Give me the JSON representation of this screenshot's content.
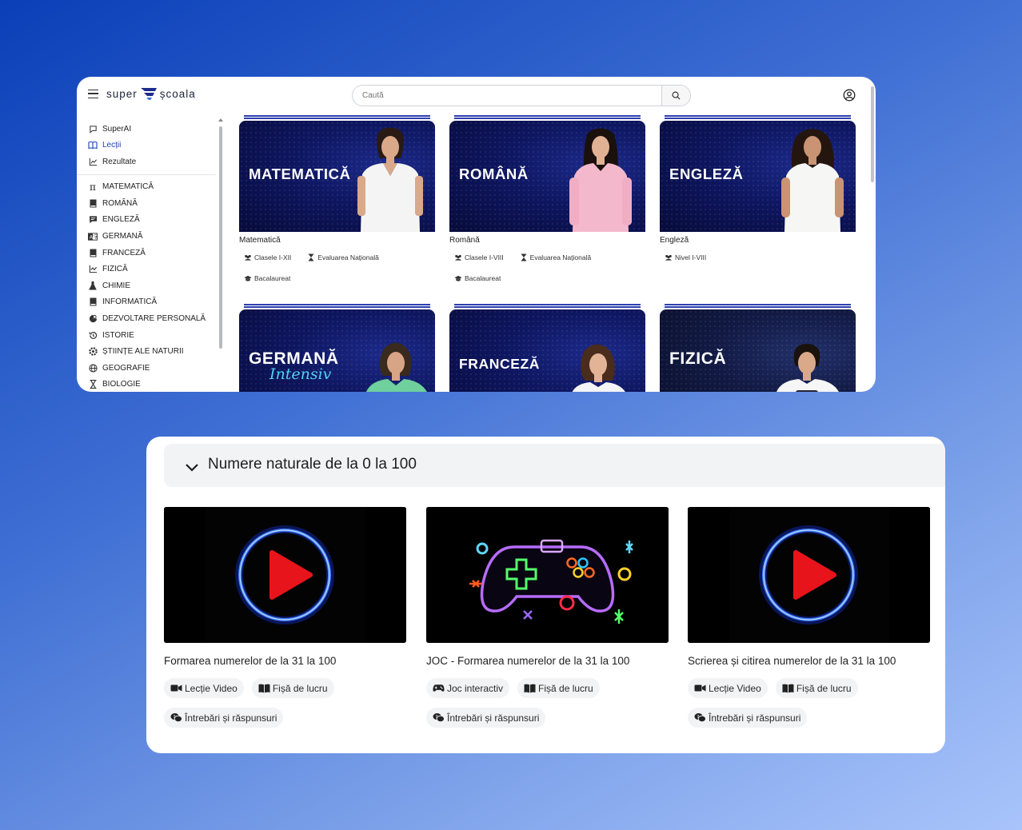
{
  "app": {
    "logo": {
      "left": "super",
      "right": "școala"
    },
    "search": {
      "placeholder": "Caută"
    },
    "sidebar": {
      "top_items": [
        {
          "label": "SuperAI",
          "icon": "chat-icon"
        },
        {
          "label": "Lecții",
          "icon": "book-icon",
          "active": true
        },
        {
          "label": "Rezultate",
          "icon": "chart-icon"
        }
      ],
      "subjects": [
        {
          "label": "MATEMATICĂ",
          "icon": "pi-icon"
        },
        {
          "label": "ROMÂNĂ",
          "icon": "book-icon"
        },
        {
          "label": "ENGLEZĂ",
          "icon": "speech-icon"
        },
        {
          "label": "GERMANĂ",
          "icon": "language-icon"
        },
        {
          "label": "FRANCEZĂ",
          "icon": "book-icon"
        },
        {
          "label": "FIZICĂ",
          "icon": "graph-icon"
        },
        {
          "label": "CHIMIE",
          "icon": "flask-icon"
        },
        {
          "label": "INFORMATICĂ",
          "icon": "book-icon"
        },
        {
          "label": "DEZVOLTARE PERSONALĂ",
          "icon": "brain-icon"
        },
        {
          "label": "ISTORIE",
          "icon": "history-icon"
        },
        {
          "label": "ȘTIINȚE ALE NATURII",
          "icon": "atom-icon"
        },
        {
          "label": "GEOGRAFIE",
          "icon": "globe-icon"
        },
        {
          "label": "BIOLOGIE",
          "icon": "hourglass-icon"
        }
      ]
    },
    "cards": [
      {
        "title": "MATEMATICĂ",
        "name": "Matematică",
        "tags": [
          {
            "label": "Clasele I-XII",
            "icon": "users-icon"
          },
          {
            "label": "Evaluarea Națională",
            "icon": "hourglass-icon"
          },
          {
            "label": "Bacalaureat",
            "icon": "graduation-cap-icon"
          }
        ]
      },
      {
        "title": "ROMÂNĂ",
        "name": "Română",
        "tags": [
          {
            "label": "Clasele I-VIII",
            "icon": "users-icon"
          },
          {
            "label": "Evaluarea Națională",
            "icon": "hourglass-icon"
          },
          {
            "label": "Bacalaureat",
            "icon": "graduation-cap-icon"
          }
        ]
      },
      {
        "title": "ENGLEZĂ",
        "name": "Engleză",
        "tags": [
          {
            "label": "Nivel I-VIII",
            "icon": "users-icon"
          }
        ]
      },
      {
        "title": "GERMANĂ",
        "subtitle": "Intensiv"
      },
      {
        "title": "FRANCEZĂ"
      },
      {
        "title": "FIZICĂ"
      }
    ]
  },
  "lesson_panel": {
    "section_title": "Numere naturale de la 0 la 100",
    "lessons": [
      {
        "title": "Formarea numerelor de la 31 la 100",
        "thumbnail": "play-icon",
        "tags": [
          {
            "label": "Lecție Video",
            "icon": "video-camera-icon"
          },
          {
            "label": "Fișă de lucru",
            "icon": "book-open-icon"
          },
          {
            "label": "Întrebări și răspunsuri",
            "icon": "comments-icon"
          }
        ]
      },
      {
        "title": "JOC - Formarea numerelor de la 31 la 100",
        "thumbnail": "gamepad-icon",
        "tags": [
          {
            "label": "Joc interactiv",
            "icon": "gamepad-icon"
          },
          {
            "label": "Fișă de lucru",
            "icon": "book-open-icon"
          },
          {
            "label": "Întrebări și răspunsuri",
            "icon": "comments-icon"
          }
        ]
      },
      {
        "title": "Scrierea și citirea numerelor de la 31 la 100",
        "thumbnail": "play-icon",
        "tags": [
          {
            "label": "Lecție Video",
            "icon": "video-camera-icon"
          },
          {
            "label": "Fișă de lucru",
            "icon": "book-open-icon"
          },
          {
            "label": "Întrebări și răspunsuri",
            "icon": "comments-icon"
          }
        ]
      }
    ]
  },
  "colors": {
    "accent": "#1b3fb0",
    "card_bg": "#0e1660",
    "play_red": "#e8141b",
    "neon_blue": "#2a6bff"
  }
}
